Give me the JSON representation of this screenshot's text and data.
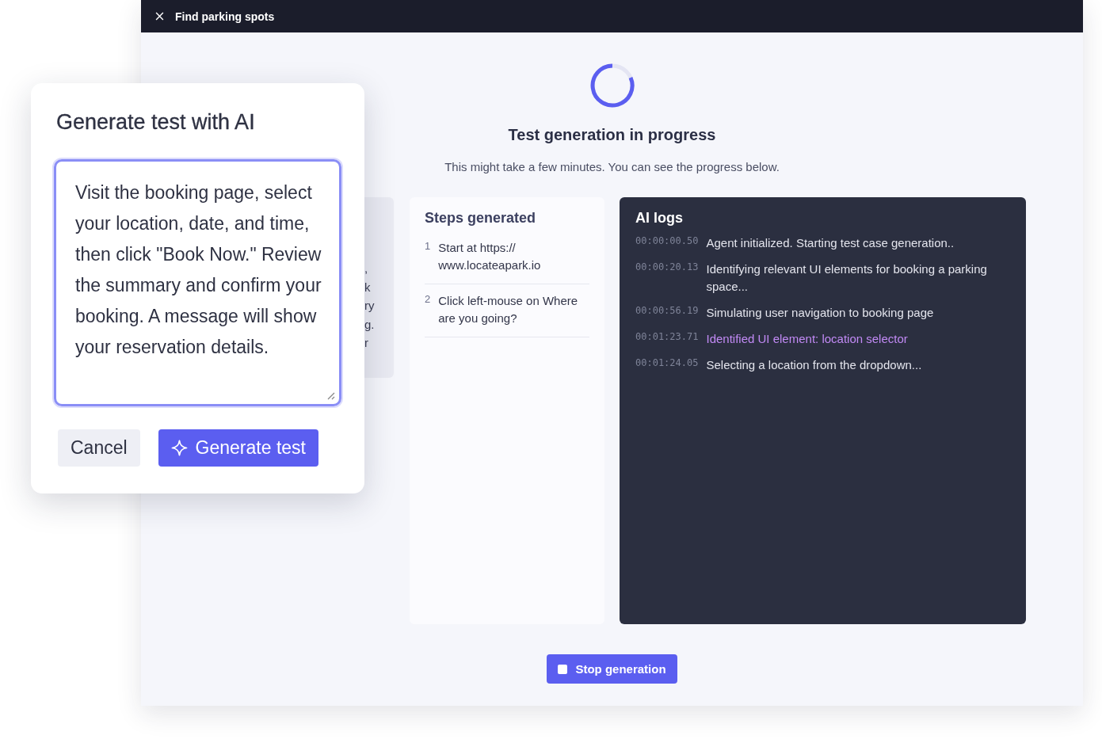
{
  "window": {
    "title": "Find parking spots"
  },
  "progress": {
    "title": "Test generation in progress",
    "subtitle": "This might take a few minutes. You can see the progress below."
  },
  "hidden_panel": {
    "fragments": [
      ",",
      "k",
      "ry",
      "g.",
      "r"
    ]
  },
  "steps": {
    "title": "Steps generated",
    "items": [
      {
        "number": "1",
        "text": "Start at https:// www.locateapark.io"
      },
      {
        "number": "2",
        "text": "Click left-mouse on Where are you going?"
      }
    ]
  },
  "logs": {
    "title": "AI logs",
    "entries": [
      {
        "time": "00:00:00.50",
        "text": "Agent initialized. Starting test case generation..",
        "kind": "normal"
      },
      {
        "time": "00:00:20.13",
        "text": "Identifying relevant UI elements for booking a parking space...",
        "kind": "normal"
      },
      {
        "time": "00:00:56.19",
        "text": "Simulating user navigation to booking page",
        "kind": "normal"
      },
      {
        "time": "00:01:23.71",
        "text": "Identified UI element: location selector",
        "kind": "highlight"
      },
      {
        "time": "00:01:24.05",
        "text": "Selecting a location from the dropdown...",
        "kind": "normal"
      }
    ]
  },
  "stop_button": "Stop generation",
  "dialog": {
    "title": "Generate test with AI",
    "prompt": "Visit the booking page, select your location, date, and time, then click \"Book Now.\" Review the summary and confirm your booking. A message will show your reservation details.",
    "cancel": "Cancel",
    "generate": "Generate test"
  }
}
